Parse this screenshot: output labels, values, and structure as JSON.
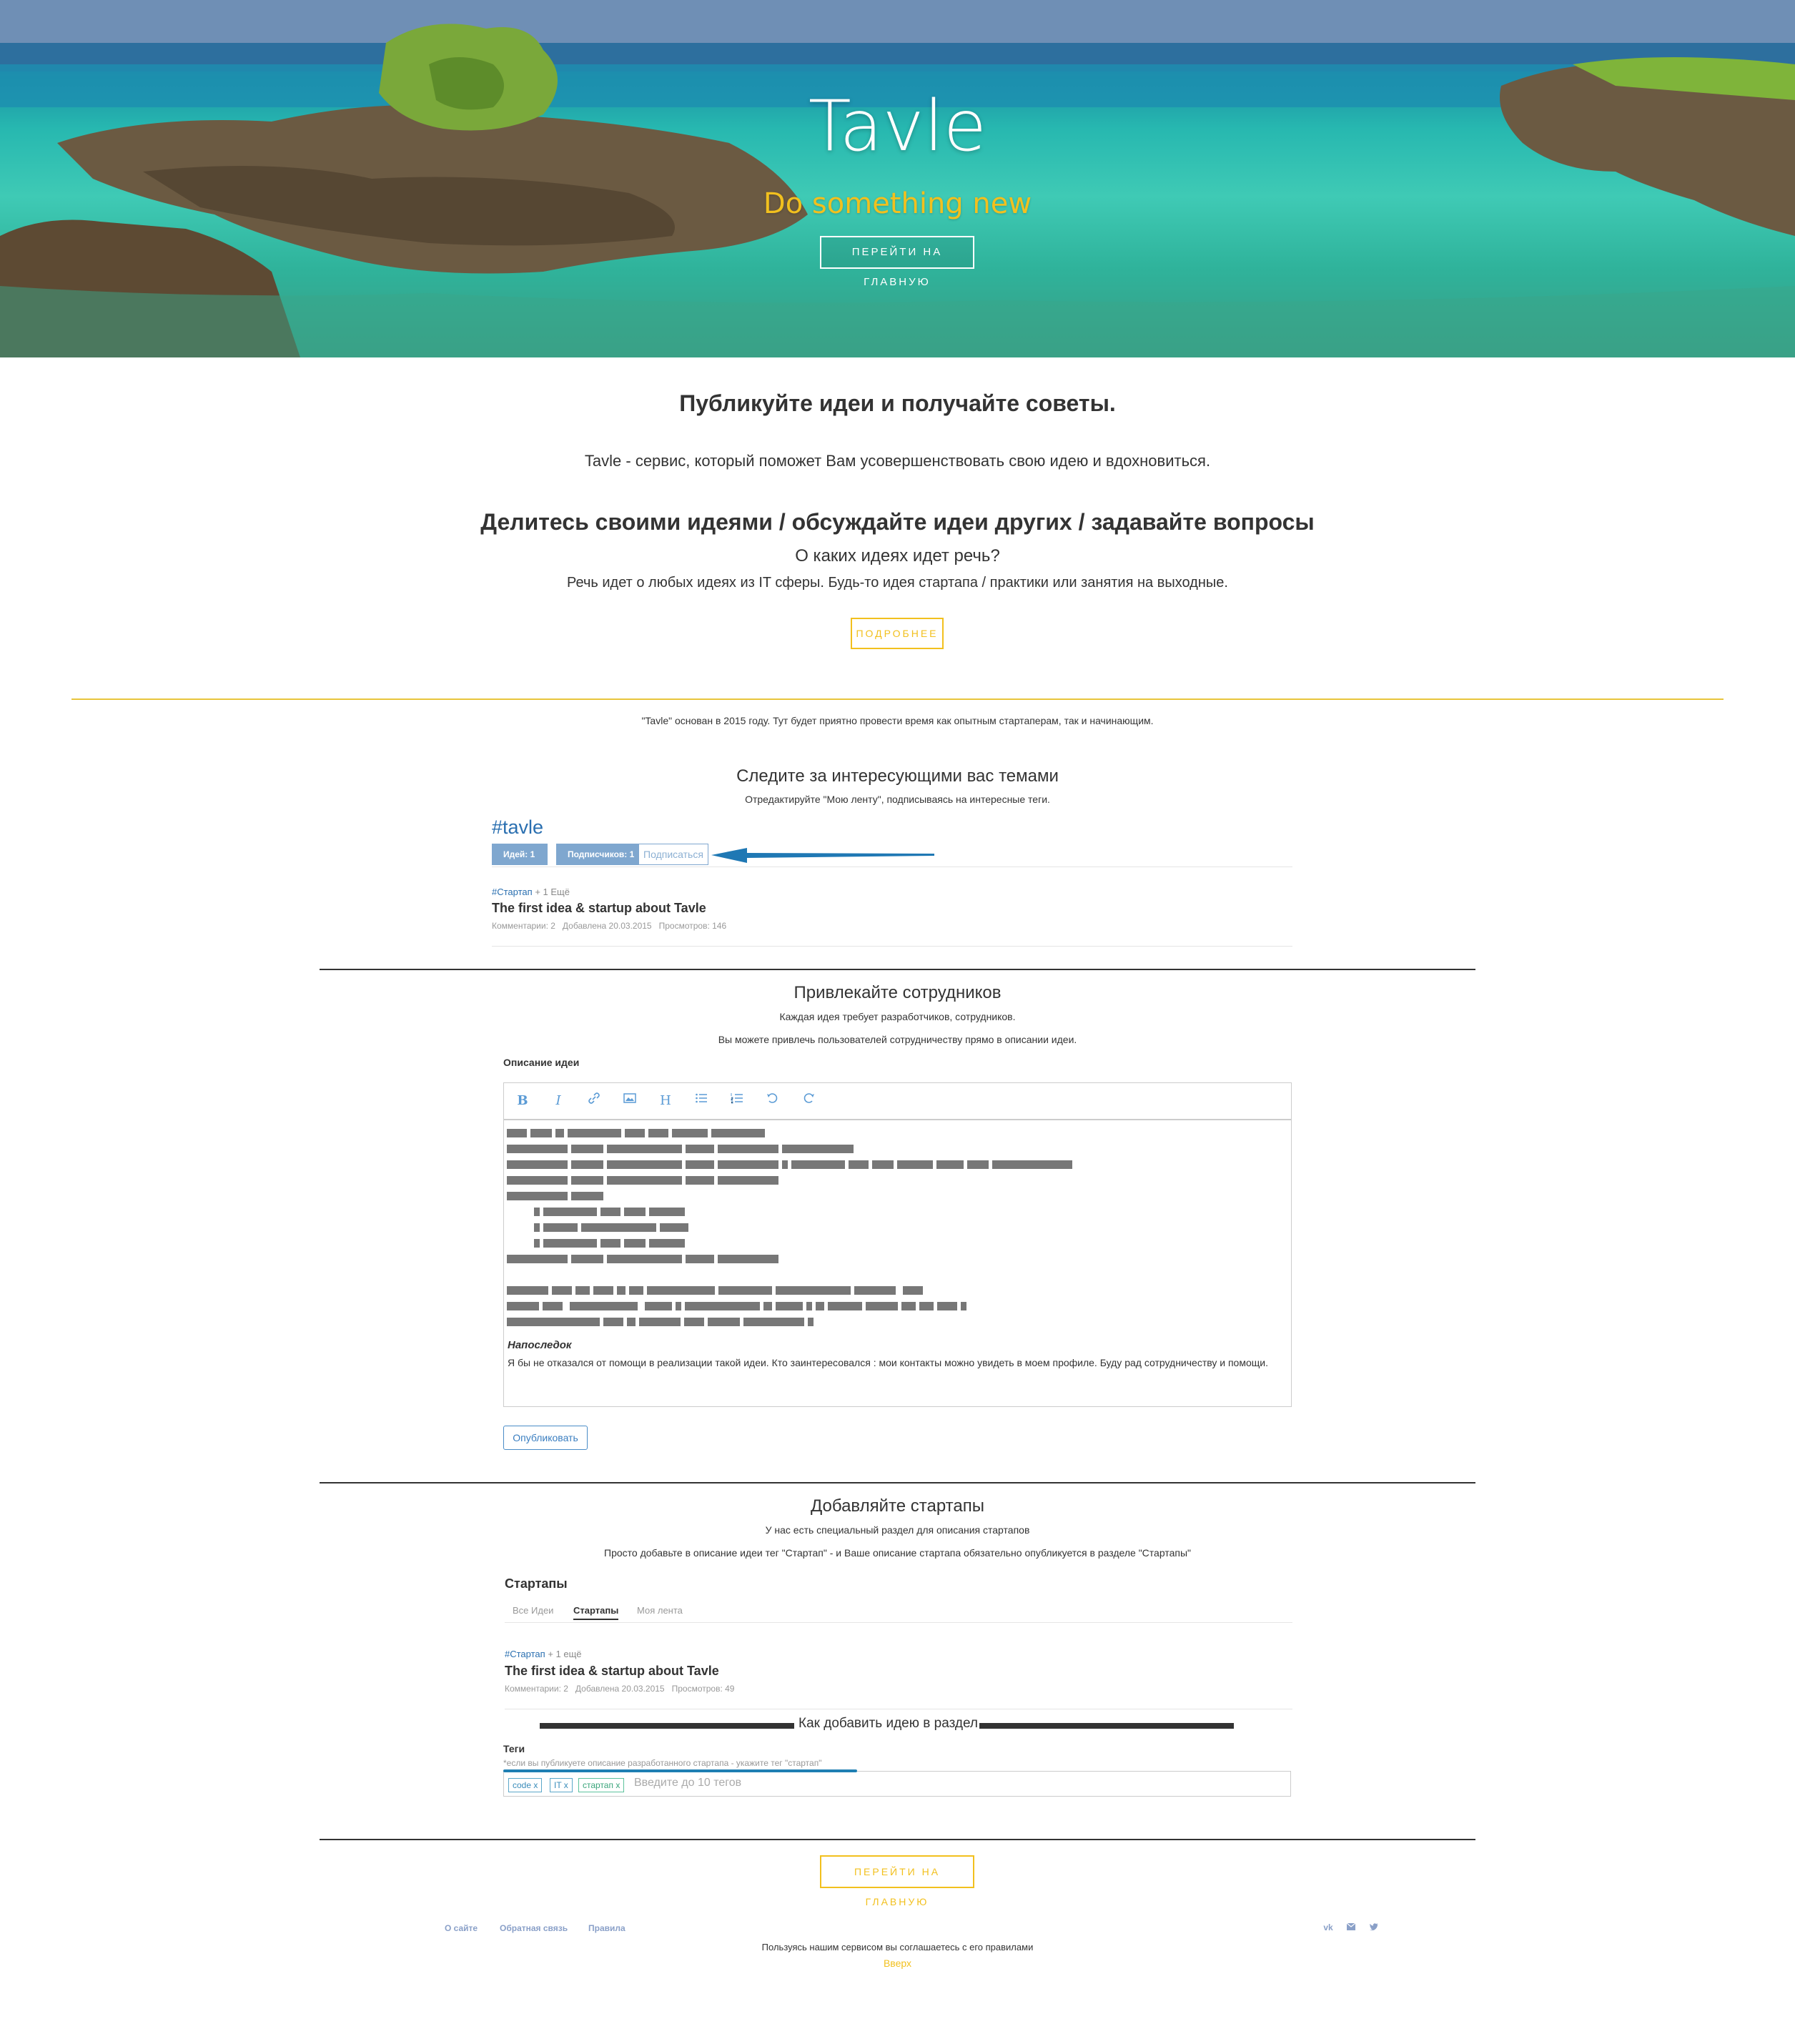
{
  "hero": {
    "title": "Tavle",
    "subtitle": "Do something new",
    "button": "ПЕРЕЙТИ НА ГЛАВНУЮ"
  },
  "intro": {
    "heading": "Публикуйте идеи и получайте советы.",
    "description": "Tavle - сервис, который поможет Вам усовершенствовать свою идею и вдохновиться.",
    "share_heading": "Делитесь своими идеями / обсуждайте идеи других / задавайте вопросы",
    "which_heading": "О каких идеях идет речь?",
    "which_text": "Речь идет о любых идеях из IT сферы. Будь-то идея стартапа / практики или занятия на выходные.",
    "more_button": "ПОДРОБНЕЕ"
  },
  "founded": "\"Tavle\" основан в 2015 году. Тут будет приятно провести время как опытным стартаперам, так и начинающим.",
  "follow": {
    "title": "Следите за интересующими вас темами",
    "text": "Отредактируйте \"Мою ленту\", подписываясь на интересные теги.",
    "tag_name": "#tavle",
    "ideas_badge": "Идей: 1",
    "subs_badge": "Подписчиков: 1",
    "subscribe": "Подписаться",
    "idea": {
      "tag": "#Стартап",
      "more": "+ 1 Ещё",
      "title": "The first idea & startup about Tavle",
      "meta": "Комментарии: 2   Добавлена 20.03.2015   Просмотров: 146"
    }
  },
  "recruit": {
    "title": "Привлекайте сотрудников",
    "text1": "Каждая идея требует разработчиков, сотрудников.",
    "text2": "Вы можете привлечь пользователей сотрудничеству прямо в описании идеи.",
    "editor_label": "Описание идеи",
    "toolbar": [
      "B",
      "I",
      "link",
      "image",
      "H",
      "ul",
      "ol",
      "undo",
      "redo"
    ],
    "afterword_title": "Напоследок",
    "afterword_text": "Я бы не отказался от помощи в реализации такой идеи. Кто заинтересовался : мои контакты можно увидеть в моем профиле. Буду рад сотрудничеству и помощи.",
    "publish_button": "Опубликовать"
  },
  "startups": {
    "title": "Добавляйте стартапы",
    "text1": "У нас есть специальный раздел для описания стартапов",
    "text2": "Просто добавьте в описание идеи тег \"Стартап\" - и Ваше описание стартапа обязательно опубликуется в разделе \"Стартапы\"",
    "section_label": "Стартапы",
    "tabs": [
      "Все Идеи",
      "Стартапы",
      "Моя лента"
    ],
    "idea": {
      "tag": "#Стартап",
      "more": "+ 1 ещё",
      "title": "The first idea & startup about Tavle",
      "meta": "Комментарии: 2   Добавлена 20.03.2015   Просмотров: 49"
    },
    "howto": "Как добавить идею в раздел",
    "tags_label": "Теги",
    "tags_hint": "*если вы публикуете описание разработанного стартапа - укажите тег \"стартап\"",
    "chips": [
      "code x",
      "IT x",
      "стартап x"
    ],
    "tags_placeholder": "Введите до 10 тегов"
  },
  "home_button": "ПЕРЕЙТИ НА ГЛАВНУЮ",
  "footer": {
    "links": [
      "О сайте",
      "Обратная связь",
      "Правила"
    ],
    "icons": [
      "vk-icon",
      "mail-icon",
      "twitter-icon"
    ],
    "agreement": "Пользуясь нашим сервисом вы соглашаетесь с его правилами",
    "top_link": "Вверх"
  },
  "colors": {
    "accent": "#f2c01e",
    "link": "#2a6fb0",
    "badge": "#7fa7cf"
  }
}
